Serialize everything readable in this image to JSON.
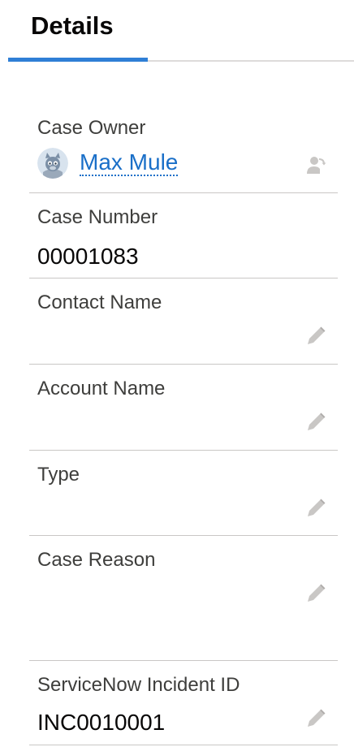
{
  "tabs": {
    "details_label": "Details"
  },
  "fields": {
    "case_owner": {
      "label": "Case Owner",
      "value": "Max Mule"
    },
    "case_number": {
      "label": "Case Number",
      "value": "00001083"
    },
    "contact_name": {
      "label": "Contact Name",
      "value": ""
    },
    "account_name": {
      "label": "Account Name",
      "value": ""
    },
    "type": {
      "label": "Type",
      "value": ""
    },
    "case_reason": {
      "label": "Case Reason",
      "value": ""
    },
    "servicenow_incident_id": {
      "label": "ServiceNow Incident ID",
      "value": "INC0010001"
    }
  },
  "colors": {
    "accent": "#2f7fd6",
    "link": "#1a6fc8",
    "icon": "#c9c7c5"
  },
  "icons": {
    "edit": "pencil-icon",
    "change_owner": "change-owner-icon",
    "avatar": "mule-avatar-icon"
  }
}
